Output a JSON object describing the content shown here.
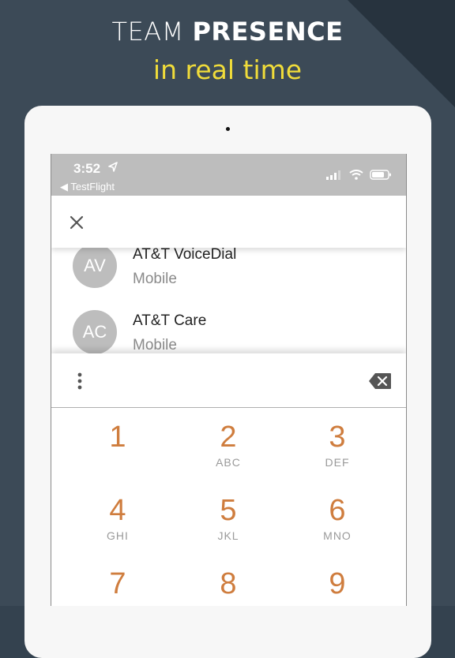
{
  "headline": {
    "line1_thin": "TEAM ",
    "line1_bold": "PRESENCE",
    "line2": "in real time"
  },
  "colors": {
    "background": "#34424f",
    "accent_yellow": "#f0dc3a",
    "keypad_digit": "#cf7d3e",
    "avatar_gray": "#bdbdbd"
  },
  "status_bar": {
    "time": "3:52",
    "back_app": "TestFlight",
    "icons": [
      "location-arrow-icon",
      "signal-icon",
      "wifi-icon",
      "battery-icon"
    ]
  },
  "contacts": [
    {
      "initials": "AV",
      "name": "AT&T VoiceDial",
      "type": "Mobile"
    },
    {
      "initials": "AC",
      "name": "AT&T Care",
      "type": "Mobile"
    }
  ],
  "keypad": [
    {
      "digit": "1",
      "letters": ""
    },
    {
      "digit": "2",
      "letters": "ABC"
    },
    {
      "digit": "3",
      "letters": "DEF"
    },
    {
      "digit": "4",
      "letters": "GHI"
    },
    {
      "digit": "5",
      "letters": "JKL"
    },
    {
      "digit": "6",
      "letters": "MNO"
    },
    {
      "digit": "7",
      "letters": ""
    },
    {
      "digit": "8",
      "letters": ""
    },
    {
      "digit": "9",
      "letters": ""
    }
  ]
}
